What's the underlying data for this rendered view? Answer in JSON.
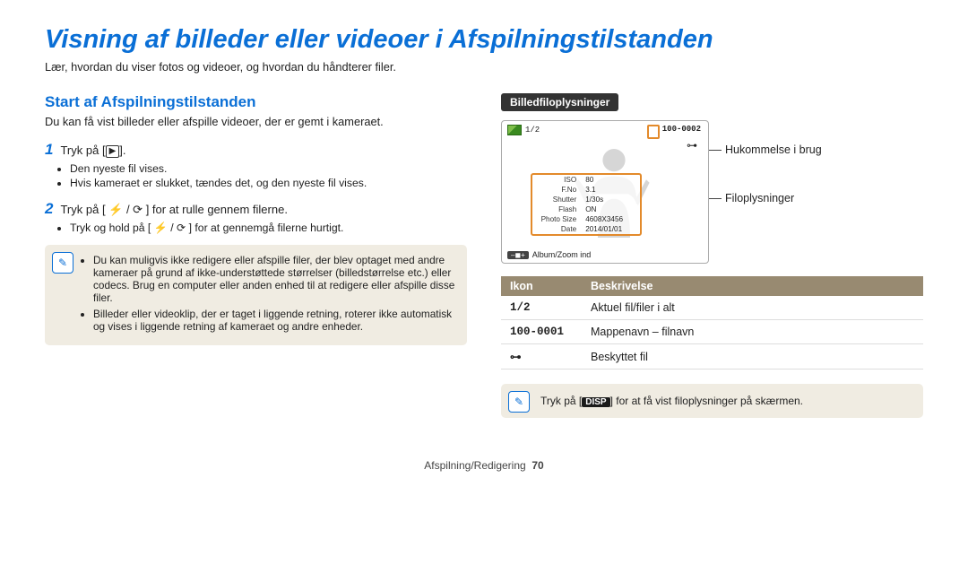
{
  "title": "Visning af billeder eller videoer i Afspilningstilstanden",
  "lead": "Lær, hvordan du viser fotos og videoer, og hvordan du håndterer filer.",
  "left": {
    "heading": "Start af Afspilningstilstanden",
    "intro": "Du kan få vist billeder eller afspille videoer, der er gemt i kameraet.",
    "step1_num": "1",
    "step1_pre": "Tryk på [",
    "step1_btn": "▶",
    "step1_post": "].",
    "step1_b1": "Den nyeste fil vises.",
    "step1_b2": "Hvis kameraet er slukket, tændes det, og den nyeste fil vises.",
    "step2_num": "2",
    "step2_text": "Tryk på [ ⚡ / ⟳ ] for at rulle gennem filerne.",
    "step2_b1": "Tryk og hold på [ ⚡ / ⟳ ] for at gennemgå filerne hurtigt.",
    "note1": "Du kan muligvis ikke redigere eller afspille filer, der blev optaget med andre kameraer på grund af ikke-understøttede størrelser (billedstørrelse etc.) eller codecs. Brug en computer eller anden enhed til at redigere eller afspille disse filer.",
    "note2": "Billeder eller videoklip, der er taget i liggende retning, roterer ikke automatisk og vises i liggende retning af kameraet og andre enheder."
  },
  "right": {
    "pill": "Billedfiloplysninger",
    "lcd": {
      "countlabel": "1/2",
      "filenum": "100-0002",
      "info": {
        "iso_l": "ISO",
        "iso_v": "80",
        "fno_l": "F.No",
        "fno_v": "3.1",
        "sh_l": "Shutter",
        "sh_v": "1/30s",
        "fl_l": "Flash",
        "fl_v": "ON",
        "ps_l": "Photo Size",
        "ps_v": "4608X3456",
        "dt_l": "Date",
        "dt_v": "2014/01/01"
      },
      "zoomchip": "–◼+",
      "bottom": "Album/Zoom ind"
    },
    "call1": "Hukommelse i brug",
    "call2": "Filoplysninger",
    "table": {
      "h_icon": "Ikon",
      "h_desc": "Beskrivelse",
      "r1_icon": "1/2",
      "r1_desc": "Aktuel fil/filer i alt",
      "r2_icon": "100-0001",
      "r2_desc": "Mappenavn – filnavn",
      "r3_icon": "⊶",
      "r3_desc": "Beskyttet fil"
    },
    "tip_pre": "Tryk på [",
    "tip_btn": "DISP",
    "tip_post": "] for at få vist filoplysninger på skærmen."
  },
  "footer_label": "Afspilning/Redigering",
  "footer_page": "70"
}
